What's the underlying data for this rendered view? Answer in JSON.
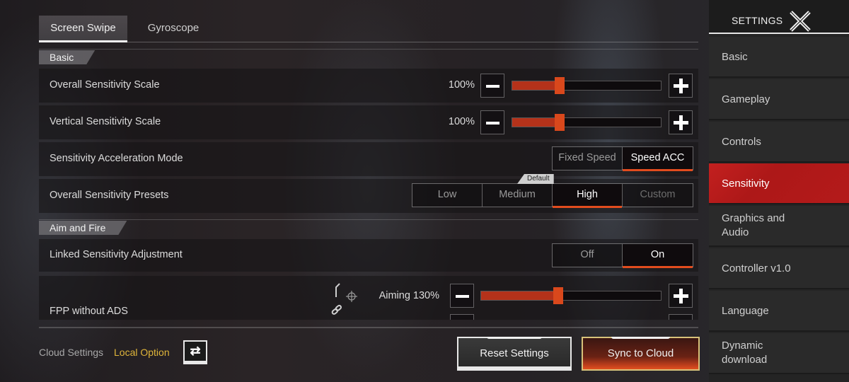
{
  "tabs": [
    {
      "label": "Screen Swipe",
      "active": true
    },
    {
      "label": "Gyroscope",
      "active": false
    }
  ],
  "sections": {
    "basic": "Basic",
    "aim_and_fire": "Aim and Fire"
  },
  "rows": {
    "overall_sensitivity": {
      "label": "Overall Sensitivity Scale",
      "value_text": "100%",
      "slider_fraction": 0.32
    },
    "vertical_sensitivity": {
      "label": "Vertical Sensitivity Scale",
      "value_text": "100%",
      "slider_fraction": 0.32
    },
    "acceleration_mode": {
      "label": "Sensitivity Acceleration Mode",
      "options": [
        "Fixed Speed",
        "Speed ACC"
      ],
      "selected": "Speed ACC"
    },
    "presets": {
      "label": "Overall Sensitivity Presets",
      "options": [
        "Low",
        "Medium",
        "High",
        "Custom"
      ],
      "selected": "High",
      "default_tag": "Default",
      "disabled": "Custom"
    },
    "linked_adjustment": {
      "label": "Linked Sensitivity Adjustment",
      "options": [
        "Off",
        "On"
      ],
      "selected": "On"
    },
    "fpp_without_ads": {
      "label": "FPP without ADS",
      "aiming_text": "Aiming 130%",
      "slider_fraction": 0.43
    }
  },
  "bottom": {
    "cloud_settings_label": "Cloud Settings",
    "local_option_label": "Local Option",
    "swap_icon": "⇄",
    "reset_label": "Reset Settings",
    "sync_label": "Sync to Cloud"
  },
  "sidebar": {
    "title": "SETTINGS",
    "items": [
      {
        "label": "Basic",
        "active": false
      },
      {
        "label": "Gameplay",
        "active": false
      },
      {
        "label": "Controls",
        "active": false
      },
      {
        "label": "Sensitivity",
        "active": true
      },
      {
        "label": "Graphics and Audio",
        "active": false
      },
      {
        "label": "Controller v1.0",
        "active": false
      },
      {
        "label": "Language",
        "active": false
      },
      {
        "label": "Dynamic download",
        "active": false
      }
    ]
  },
  "colors": {
    "accent": "#e24c1e",
    "sidebar_active": "#c3201f",
    "local_option": "#e0b53a"
  }
}
